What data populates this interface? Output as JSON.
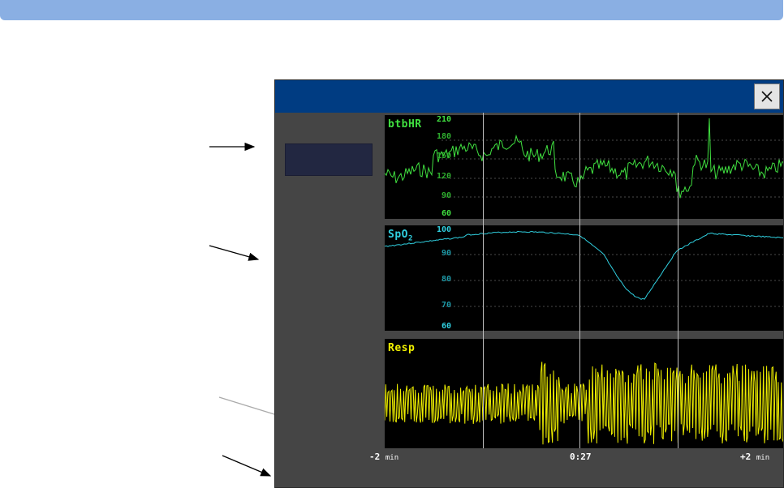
{
  "window": {
    "close_icon": "close-icon"
  },
  "panels": {
    "hr": {
      "label": "btbHR",
      "color": "#40e040",
      "ticks": [
        "210",
        "180",
        "150",
        "120",
        "90",
        "60"
      ]
    },
    "spo2": {
      "label": "SpO",
      "label_sub": "2",
      "color": "#30d0e0",
      "ticks": [
        "100",
        "90",
        "80",
        "70",
        "60"
      ]
    },
    "resp": {
      "label": "Resp",
      "color": "#f0f000"
    }
  },
  "timeline": {
    "left_label": "-2",
    "left_unit": "min",
    "center_label": "0:27",
    "right_label": "+2",
    "right_unit": "min"
  }
}
